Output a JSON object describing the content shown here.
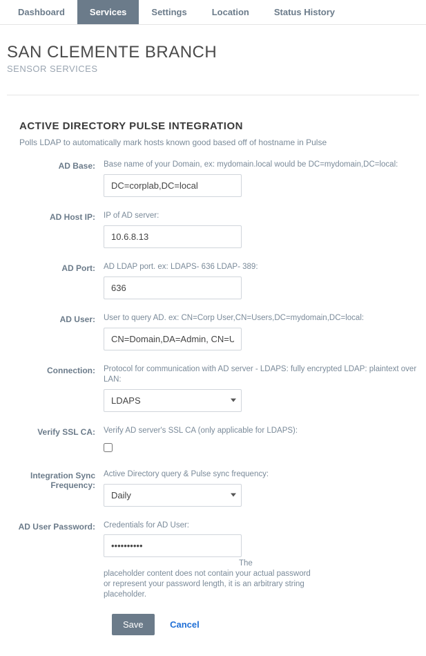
{
  "tabs": {
    "dashboard": "Dashboard",
    "services": "Services",
    "settings": "Settings",
    "location": "Location",
    "statusHistory": "Status History"
  },
  "header": {
    "title": "SAN CLEMENTE BRANCH",
    "subtitle": "SENSOR SERVICES"
  },
  "section": {
    "title": "ACTIVE DIRECTORY PULSE INTEGRATION",
    "desc": "Polls LDAP to automatically mark hosts known good based off of hostname in Pulse"
  },
  "fields": {
    "adBase": {
      "label": "AD Base:",
      "help": "Base name of your Domain, ex: mydomain.local would be DC=mydomain,DC=local:",
      "value": "DC=corplab,DC=local"
    },
    "adHostIp": {
      "label": "AD Host IP:",
      "help": "IP of AD server:",
      "value": "10.6.8.13"
    },
    "adPort": {
      "label": "AD Port:",
      "help": "AD LDAP port. ex: LDAPS- 636 LDAP- 389:",
      "value": "636"
    },
    "adUser": {
      "label": "AD User:",
      "help": "User to query AD. ex: CN=Corp User,CN=Users,DC=mydomain,DC=local:",
      "value": "CN=Domain,DA=Admin, CN=U"
    },
    "connection": {
      "label": "Connection:",
      "help": "Protocol for communication with AD server - LDAPS: fully encrypted LDAP: plaintext over LAN:",
      "value": "LDAPS"
    },
    "verifySsl": {
      "label": "Verify SSL CA:",
      "help": "Verify AD server's SSL CA (only applicable for LDAPS):"
    },
    "syncFreq": {
      "label": "Integration Sync Frequency:",
      "help": "Active Directory query & Pulse sync frequency:",
      "value": "Daily"
    },
    "adPassword": {
      "label": "AD User Password:",
      "help": "Credentials for AD User:",
      "value": "••••••••••",
      "noteThe": "The",
      "note": "placeholder content does not contain your actual password or represent your password length, it is an arbitrary string placeholder."
    }
  },
  "actions": {
    "save": "Save",
    "cancel": "Cancel"
  }
}
